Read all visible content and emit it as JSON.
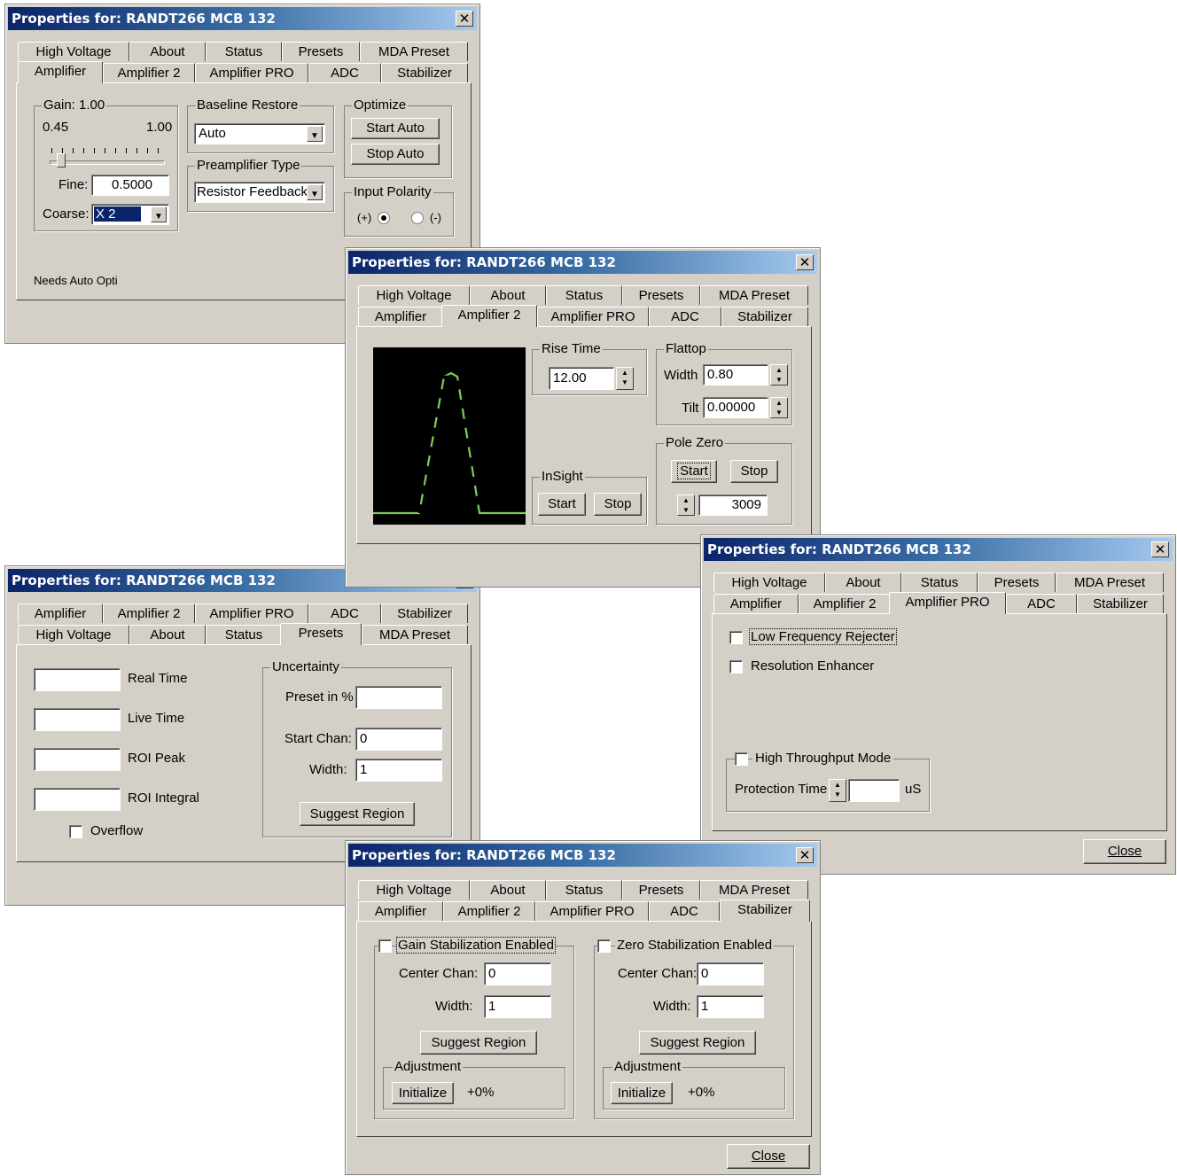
{
  "window_title": "Properties for: RANDT266 MCB 132",
  "close_x": "✕",
  "tabs": {
    "high_voltage": "High Voltage",
    "about": "About",
    "status": "Status",
    "presets": "Presets",
    "mda_preset": "MDA Preset",
    "amplifier": "Amplifier",
    "amplifier2": "Amplifier 2",
    "amplifier_pro": "Amplifier PRO",
    "adc": "ADC",
    "stabilizer": "Stabilizer"
  },
  "amplifier_window": {
    "gain_label": "Gain: 1.00",
    "gain_min": "0.45",
    "gain_max": "1.00",
    "fine_label": "Fine:",
    "fine_value": "0.5000",
    "coarse_label": "Coarse:",
    "coarse_value": "X 2",
    "baseline_restore_label": "Baseline Restore",
    "baseline_restore_value": "Auto",
    "preamp_type_label": "Preamplifier Type",
    "preamp_type_value": "Resistor Feedback",
    "optimize_label": "Optimize",
    "start_auto": "Start Auto",
    "stop_auto": "Stop Auto",
    "input_polarity_label": "Input Polarity",
    "pos_label": "(+)",
    "neg_label": "(-)",
    "status_text": "Needs Auto Opti"
  },
  "amplifier2_window": {
    "rise_time_label": "Rise Time",
    "rise_time_value": "12.00",
    "flattop_label": "Flattop",
    "width_label": "Width",
    "width_value": "0.80",
    "tilt_label": "Tilt",
    "tilt_value": "0.00000",
    "pole_zero_label": "Pole Zero",
    "pz_start": "Start",
    "pz_stop": "Stop",
    "pz_value": "3009",
    "insight_label": "InSight",
    "insight_start": "Start",
    "insight_stop": "Stop"
  },
  "presets_window": {
    "real_time": "Real Time",
    "live_time": "Live Time",
    "roi_peak": "ROI Peak",
    "roi_integral": "ROI Integral",
    "overflow": "Overflow",
    "uncertainty_label": "Uncertainty",
    "preset_in_pct": "Preset in %",
    "start_chan_label": "Start Chan:",
    "start_chan_value": "0",
    "width_label": "Width:",
    "width_value": "1",
    "suggest_region": "Suggest Region"
  },
  "amplifier_pro_window": {
    "low_freq_rejecter": "Low Frequency Rejecter",
    "resolution_enhancer": "Resolution Enhancer",
    "high_throughput_mode": "High Throughput Mode",
    "protection_time_label": "Protection Time",
    "protection_time_unit": "uS",
    "close": "Close"
  },
  "stabilizer_window": {
    "gain_stab_enabled": "Gain Stabilization Enabled",
    "zero_stab_enabled": "Zero Stabilization Enabled",
    "center_chan_label": "Center Chan:",
    "center_chan_value": "0",
    "width_label": "Width:",
    "width_value": "1",
    "suggest_region": "Suggest Region",
    "adjustment_label": "Adjustment",
    "initialize": "Initialize",
    "adjust_value": "+0%",
    "close": "Close"
  },
  "colors": {
    "title_start": "#0a246a",
    "title_end": "#a6caf0",
    "face": "#d4d0c8",
    "scope_bg": "#000000",
    "scope_trace": "#7ccf5a",
    "selection": "#0a246a"
  }
}
